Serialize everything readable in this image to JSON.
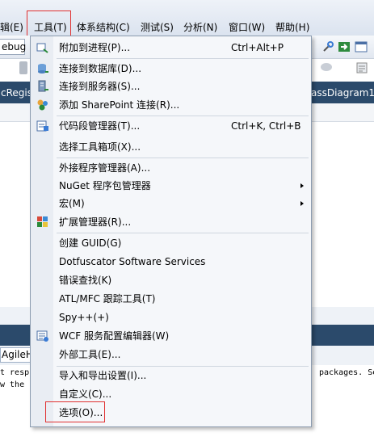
{
  "menubar": {
    "items": [
      "辑(E)",
      "工具(T)",
      "体系结构(C)",
      "测试(S)",
      "分析(N)",
      "窗口(W)",
      "帮助(H)"
    ]
  },
  "toolbar": {
    "config_combo": "ebug"
  },
  "tabs": {
    "left": "cRegis",
    "right": "assDiagram1."
  },
  "panel": {
    "tab": "AgileH",
    "line1_left": "t resp",
    "line1_right": "packages. Se",
    "line2_left": "w the f"
  },
  "menu": {
    "items": [
      {
        "label": "附加到进程(P)...",
        "shortcut": "Ctrl+Alt+P",
        "icon": "attach-process-icon"
      },
      {
        "label": "连接到数据库(D)...",
        "icon": "database-connect-icon"
      },
      {
        "label": "连接到服务器(S)...",
        "icon": "server-connect-icon"
      },
      {
        "label": "添加 SharePoint 连接(R)...",
        "icon": "sharepoint-icon"
      },
      {
        "label": "代码段管理器(T)...",
        "shortcut": "Ctrl+K, Ctrl+B",
        "icon": "snippet-manager-icon"
      },
      {
        "label": "选择工具箱项(X)..."
      },
      {
        "label": "外接程序管理器(A)..."
      },
      {
        "label": "NuGet 程序包管理器",
        "submenu": true
      },
      {
        "label": "宏(M)",
        "submenu": true
      },
      {
        "label": "扩展管理器(R)...",
        "icon": "extension-manager-icon"
      },
      {
        "label": "创建 GUID(G)"
      },
      {
        "label": "Dotfuscator Software Services"
      },
      {
        "label": "错误查找(K)"
      },
      {
        "label": "ATL/MFC 跟踪工具(T)"
      },
      {
        "label": "Spy++(+)"
      },
      {
        "label": "WCF 服务配置编辑器(W)",
        "icon": "wcf-editor-icon"
      },
      {
        "label": "外部工具(E)..."
      },
      {
        "label": "导入和导出设置(I)..."
      },
      {
        "label": "自定义(C)..."
      },
      {
        "label": "选项(O)..."
      }
    ]
  }
}
